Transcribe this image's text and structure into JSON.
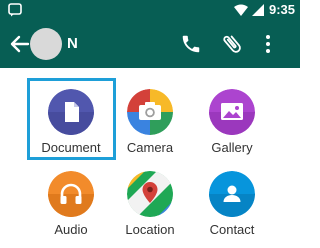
{
  "status_bar": {
    "time": "9:35",
    "icons": [
      "notification-icon",
      "wifi-icon",
      "signal-icon"
    ]
  },
  "header": {
    "contact_name": "N",
    "actions": [
      "back-arrow-icon",
      "phone-icon",
      "paperclip-icon",
      "more-vert-icon"
    ]
  },
  "attachments": [
    {
      "label": "Document",
      "icon": "document-icon",
      "color": "#5157ae",
      "selected": true
    },
    {
      "label": "Camera",
      "icon": "camera-icon",
      "color": "#d3413a",
      "selected": false
    },
    {
      "label": "Gallery",
      "icon": "gallery-icon",
      "color": "#ac44cf",
      "selected": false
    },
    {
      "label": "Audio",
      "icon": "headphones-icon",
      "color": "#f28b2b",
      "selected": false
    },
    {
      "label": "Location",
      "icon": "map-pin-icon",
      "color": "#1fa855",
      "selected": false
    },
    {
      "label": "Contact",
      "icon": "person-icon",
      "color": "#0795dc",
      "selected": false
    }
  ],
  "colors": {
    "app_bar": "#075e54",
    "selection_border": "#1e9fd8"
  }
}
